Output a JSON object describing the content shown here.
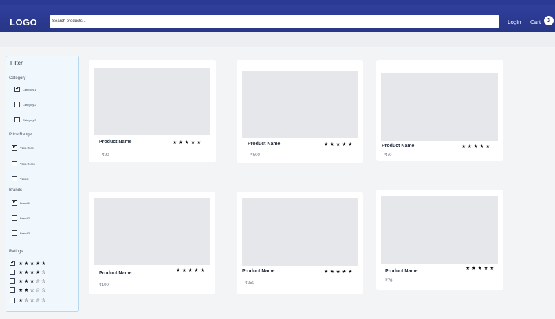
{
  "header": {
    "logo": "LOGO",
    "search_placeholder": "Search products...",
    "login": "Login",
    "cart": "Cart",
    "cart_count": "3"
  },
  "filter": {
    "title": "Filter",
    "sections": [
      {
        "title": "Category",
        "options": [
          {
            "label": "Category 1",
            "checked": true
          },
          {
            "label": "Category 2",
            "checked": false
          },
          {
            "label": "Category 3",
            "checked": false
          }
        ]
      },
      {
        "title": "Price Range",
        "options": [
          {
            "label": "₹100-₹500",
            "checked": true
          },
          {
            "label": "₹500-₹1000",
            "checked": false
          },
          {
            "label": "₹1000+",
            "checked": false
          }
        ]
      },
      {
        "title": "Brands",
        "options": [
          {
            "label": "Brand 1",
            "checked": true
          },
          {
            "label": "Brand 2",
            "checked": false
          },
          {
            "label": "Brand 3",
            "checked": false
          }
        ]
      }
    ],
    "ratings": {
      "title": "Ratings",
      "options": [
        {
          "stars": "★★★★★",
          "checked": true
        },
        {
          "stars": "★★★★☆",
          "checked": false
        },
        {
          "stars": "★★★☆☆",
          "checked": false
        },
        {
          "stars": "★★☆☆☆",
          "checked": false
        },
        {
          "stars": "★☆☆☆☆",
          "checked": false
        }
      ]
    }
  },
  "products": [
    {
      "name": "Product Name",
      "price": "₹90",
      "stars": "★★★★★"
    },
    {
      "name": "Product Name",
      "price": "₹500",
      "stars": "★★★★★"
    },
    {
      "name": "Product Name",
      "price": "₹70",
      "stars": "★★★★★"
    },
    {
      "name": "Product Name",
      "price": "₹100",
      "stars": "★★★★★"
    },
    {
      "name": "Product Name",
      "price": "₹250",
      "stars": "★★★★★"
    },
    {
      "name": "Product Name",
      "price": "₹79",
      "stars": "★★★★★"
    }
  ]
}
